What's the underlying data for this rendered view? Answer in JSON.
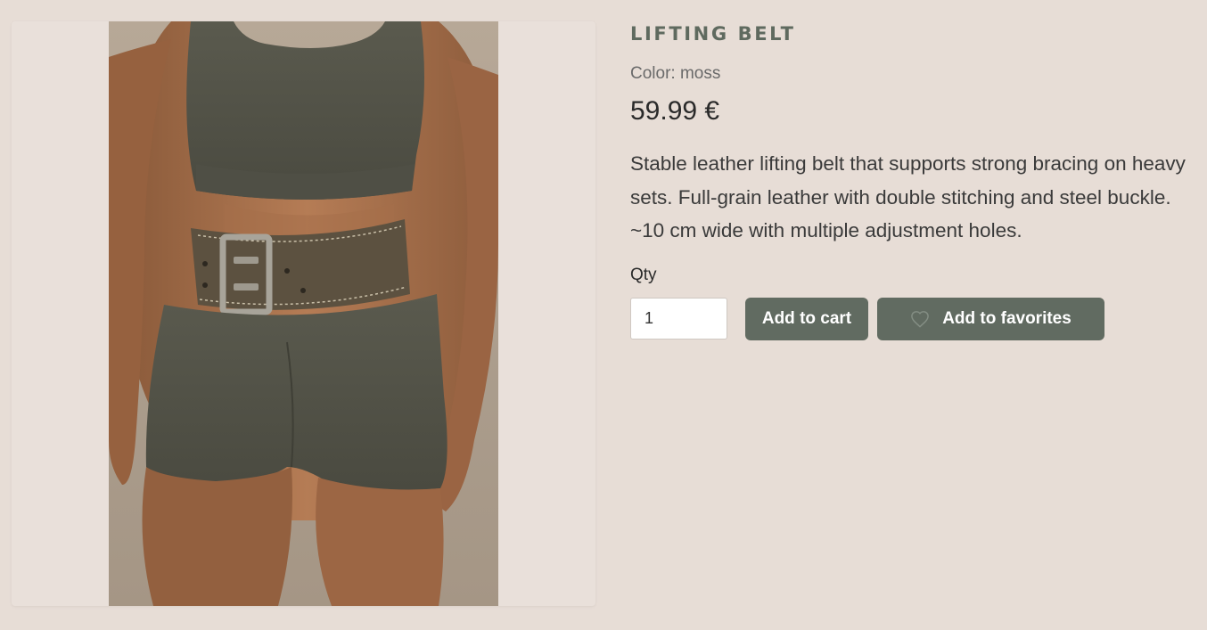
{
  "product": {
    "title": "LIFTING BELT",
    "color_label": "Color: moss",
    "price": "59.99 €",
    "description": "Stable leather lifting belt that supports strong bracing on heavy sets. Full-grain leather with double stitching and steel buckle. ~10 cm wide with multiple adjustment holes.",
    "image_alt": "Lifting belt"
  },
  "purchase": {
    "qty_label": "Qty",
    "qty_value": "1",
    "add_to_cart_label": "Add to cart",
    "add_to_favorites_label": "Add to favorites",
    "favorite_icon": "heart-outline-icon"
  },
  "colors": {
    "background": "#e7ddd6",
    "accent": "#616b61",
    "title": "#5f6a5f"
  }
}
